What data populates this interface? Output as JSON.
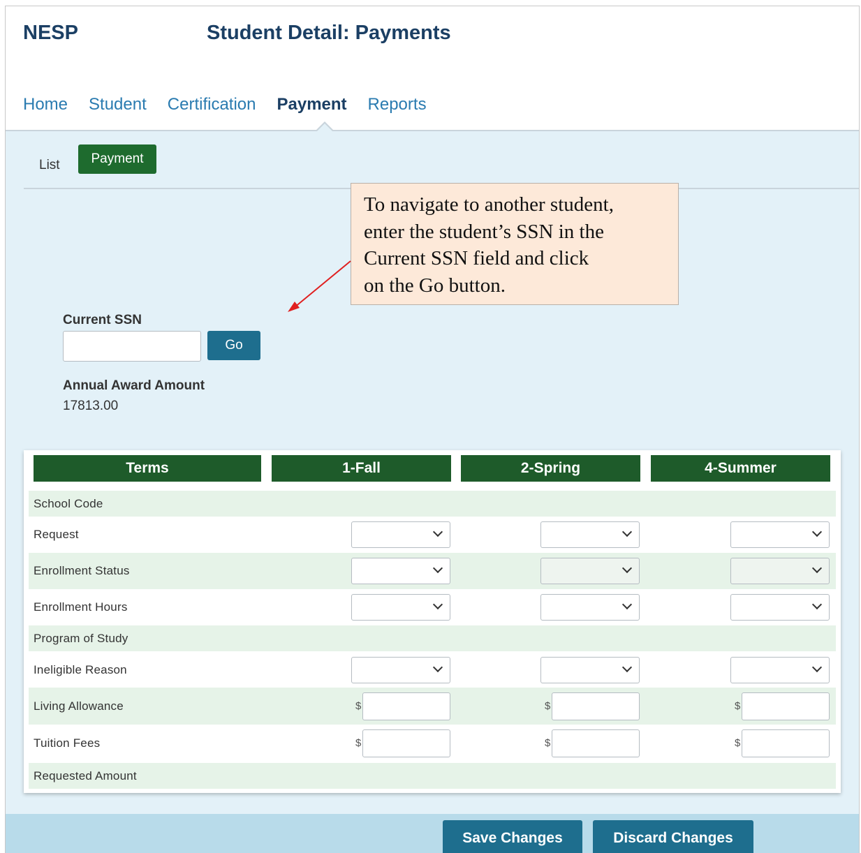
{
  "header": {
    "brand": "NESP",
    "title": "Student Detail: Payments"
  },
  "nav": {
    "items": [
      {
        "label": "Home",
        "active": false
      },
      {
        "label": "Student",
        "active": false
      },
      {
        "label": "Certification",
        "active": false
      },
      {
        "label": "Payment",
        "active": true
      },
      {
        "label": "Reports",
        "active": false
      }
    ]
  },
  "subtabs": {
    "list": "List",
    "payment": "Payment"
  },
  "callout": {
    "lines": [
      "To navigate to another student,",
      "enter the student’s SSN in the",
      "Current SSN field and click",
      "on the Go button."
    ],
    "arrow_color": "#e02020"
  },
  "ssn": {
    "label": "Current SSN",
    "value": "",
    "go_label": "Go"
  },
  "award": {
    "label": "Annual Award Amount",
    "value": "17813.00"
  },
  "table": {
    "headers": [
      "Terms",
      "1-Fall",
      "2-Spring",
      "4-Summer"
    ],
    "rows": [
      {
        "label": "School Code",
        "type": "text"
      },
      {
        "label": "Request",
        "type": "select"
      },
      {
        "label": "Enrollment Status",
        "type": "select"
      },
      {
        "label": "Enrollment Hours",
        "type": "select"
      },
      {
        "label": "Program of Study",
        "type": "text"
      },
      {
        "label": "Ineligible Reason",
        "type": "select"
      },
      {
        "label": "Living Allowance",
        "type": "money"
      },
      {
        "label": "Tuition Fees",
        "type": "money"
      },
      {
        "label": "Requested Amount",
        "type": "text"
      }
    ],
    "currency_symbol": "$"
  },
  "footer": {
    "save": "Save Changes",
    "discard": "Discard Changes"
  },
  "colors": {
    "brand_navy": "#1b3f64",
    "nav_link": "#2a7bb0",
    "green_header": "#1e5b2a",
    "button_teal": "#1e6e8e",
    "panel_bg": "#e3f1f8"
  }
}
